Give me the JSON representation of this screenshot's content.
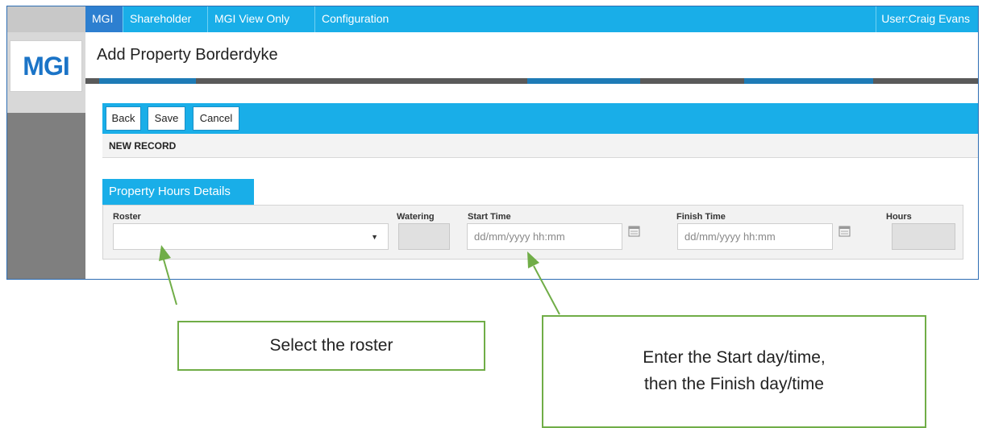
{
  "nav": {
    "items": [
      {
        "label": "MGI",
        "active": true
      },
      {
        "label": "Shareholder",
        "active": false
      },
      {
        "label": "MGI View Only",
        "active": false
      },
      {
        "label": "Configuration",
        "active": false
      }
    ],
    "user": "User:Craig Evans"
  },
  "logo": {
    "text": "MGI"
  },
  "page": {
    "title": "Add Property Borderdyke"
  },
  "toolbar": {
    "back_label": "Back",
    "save_label": "Save",
    "cancel_label": "Cancel"
  },
  "record": {
    "status": "NEW RECORD"
  },
  "section": {
    "title": "Property Hours Details"
  },
  "fields": {
    "roster": {
      "label": "Roster",
      "value": ""
    },
    "watering": {
      "label": "Watering",
      "value": ""
    },
    "start_time": {
      "label": "Start Time",
      "placeholder": "dd/mm/yyyy hh:mm"
    },
    "finish_time": {
      "label": "Finish Time",
      "placeholder": "dd/mm/yyyy hh:mm"
    },
    "hours": {
      "label": "Hours",
      "value": ""
    }
  },
  "callouts": {
    "roster": "Select the roster",
    "times_line1": "Enter the Start day/time,",
    "times_line2": "then the Finish day/time"
  },
  "colors": {
    "accent": "#19aee8",
    "active_nav": "#2d7fd0",
    "callout_border": "#70ad47"
  },
  "icons": [
    "calendar-icon",
    "chevron-down-icon"
  ]
}
